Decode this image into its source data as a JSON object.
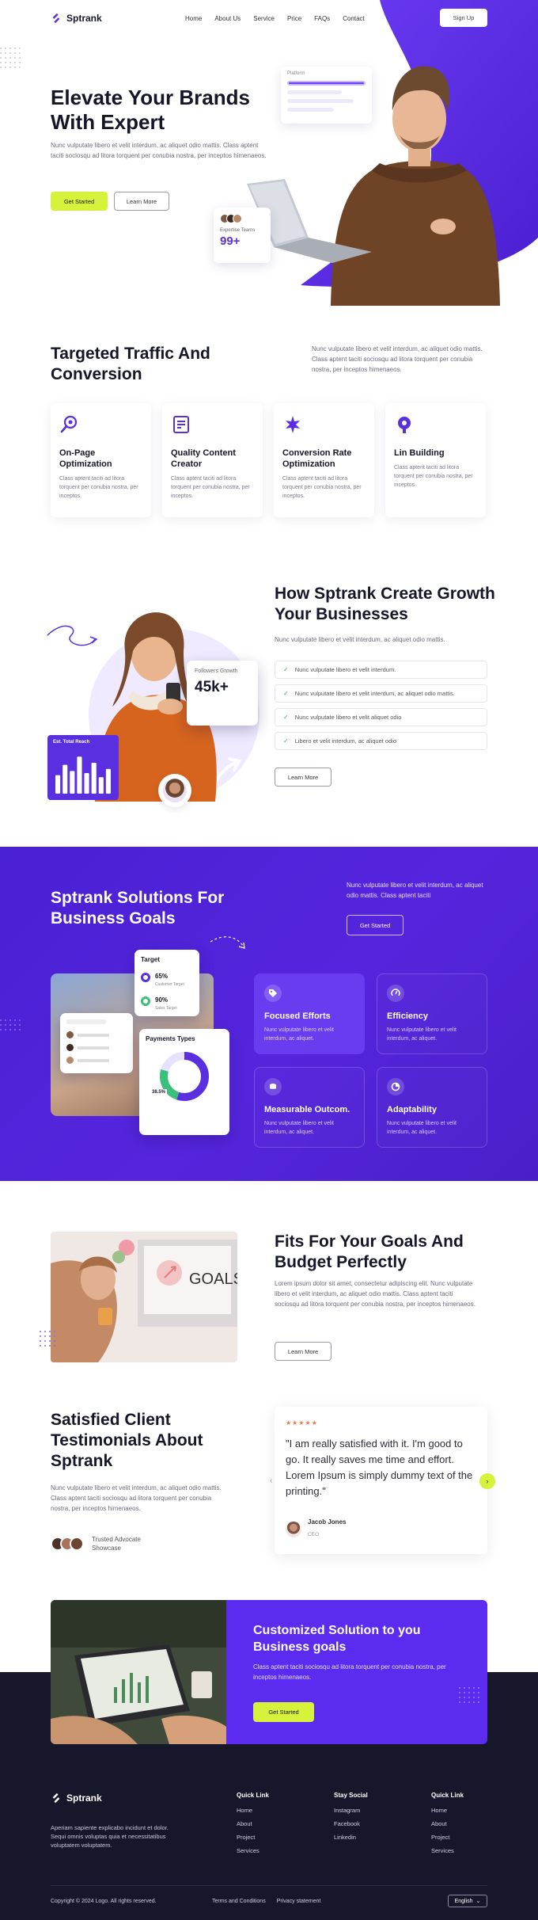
{
  "nav": {
    "brand": "Sptrank",
    "links": [
      "Home",
      "About Us",
      "Service",
      "Price",
      "FAQs",
      "Contact"
    ],
    "signup": "Sign Up"
  },
  "hero": {
    "title": "Elevate Your Brands With Expert",
    "description": "Nunc vulputate libero et velit interdum, ac aliquet odio mattis. Class aptent taciti sociosqu ad litora torquent per conubia nostra, per inceptos himenaeos.",
    "primary_cta": "Get Started",
    "secondary_cta": "Learn More",
    "platform_label": "Platform",
    "expertise_label": "Expertise Teams",
    "expertise_value": "99+"
  },
  "targeted": {
    "title": "Targeted Traffic And Conversion",
    "description": "Nunc vulputate libero et velit interdum, ac aliquet odio mattis. Class aptent taciti sociosqu ad litora torquent per conubia nostra, per inceptos himenaeos.",
    "cards": [
      {
        "icon": "magnifier-icon",
        "title": "On-Page Optimization",
        "text": "Class aptent taciti ad litora torquent per conubia nostra, per inceptos."
      },
      {
        "icon": "document-check-icon",
        "title": "Quality Content Creator",
        "text": "Class aptent taciti ad litora torquent per conubia nostra, per inceptos."
      },
      {
        "icon": "sparkle-gear-icon",
        "title": "Conversion Rate Optimization",
        "text": "Class aptent taciti ad litora torquent per conubia nostra, per inceptos."
      },
      {
        "icon": "link-building-icon",
        "title": "Lin Building",
        "text": "Class aptent taciti ad litora torquent per conubia nostra, per inceptos."
      }
    ]
  },
  "how": {
    "title": "How Sptrank Create Growth Your Businesses",
    "description": "Nunc vulputate libero et velit interdum, ac aliquet odio mattis.",
    "checklist": [
      "Nunc vulputate libero et velit interdum.",
      "Nunc vulputate libero et velit interdum, ac aliquet odio mattis.",
      "Nunc vulputate libero et velit  aliquet odio",
      "Libero et velit interdum, ac aliquet odio"
    ],
    "cta": "Learn More",
    "followers_label": "Followers Growth",
    "followers_value": "45k+",
    "reach_label": "Est. Total Reach",
    "reach_bars": [
      0.45,
      0.7,
      0.55,
      0.9,
      0.5,
      0.75,
      0.4,
      0.6
    ]
  },
  "solutions": {
    "title": "Sptrank Solutions For Business Goals",
    "description": "Nunc vulputate libero et velit interdum, ac aliquet odio mattis. Class aptent taciti",
    "cta": "Get Started",
    "target_card": {
      "title": "Target",
      "p1": "65%",
      "p1_label": "Customer Target",
      "p2": "90%",
      "p2_label": "Sales Target"
    },
    "payments_card": {
      "title": "Payments Types",
      "value": "38.5%"
    },
    "cards": [
      {
        "icon": "tag-icon",
        "title": "Focused Efforts",
        "text": "Nunc vulputate libero et velit interdum, ac aliquet."
      },
      {
        "icon": "gauge-icon",
        "title": "Efficiency",
        "text": "Nunc vulputate libero et velit interdum, ac aliquet."
      },
      {
        "icon": "coins-icon",
        "title": "Measurable Outcom.",
        "text": "Nunc vulputate libero et velit interdum, ac aliquet."
      },
      {
        "icon": "chart-circle-icon",
        "title": "Adaptability",
        "text": "Nunc vulputate libero et velit interdum, ac aliquet."
      }
    ],
    "colors": {
      "accent": "#5525dd",
      "lime": "#d6f23a"
    }
  },
  "fits": {
    "title": "Fits For Your Goals And Budget Perfectly",
    "description": "Lorem ipsum dolor sit amet, consectetur adipiscing elit. Nunc vulputate libero et velit interdum, ac aliquet odio mattis. Class aptent taciti sociosqu ad litora torquent per conubia nostra, per inceptos himenaeos.",
    "cta": "Learn More",
    "image_text": "GOALS"
  },
  "testimonials": {
    "title": "Satisfied Client Testimonials About Sptrank",
    "description": "Nunc vulputate libero et velit interdum, ac aliquet odio mattis. Class aptent taciti sociosqu ad litora torquent per conubia nostra, per inceptos himenaeos.",
    "trusted": "Trusted Advocate Showcase",
    "stars": "★★★★★",
    "quote": "\"I am really satisfied with it. I'm good to go. It really saves me time and effort. Lorem Ipsum is simply dummy text of the printing.\"",
    "author": "Jacob Jones",
    "role": "CEO"
  },
  "cta": {
    "title": "Customized Solution to you Business  goals",
    "description": "Class aptent taciti sociosqu ad litora torquent per conubia nostra, per inceptos himenaeos.",
    "button": "Get Started"
  },
  "footer": {
    "brand": "Sptrank",
    "description": "Aperiam sapiente explicabo incidunt et dolor. Sequi omnis voluptas quia et necessitatibus voluptatem voluptatem.",
    "columns": [
      {
        "title": "Quick Link",
        "links": [
          "Home",
          "About",
          "Project",
          "Services"
        ]
      },
      {
        "title": "Stay Social",
        "links": [
          "Instagram",
          "Facebook",
          "Linkedin"
        ]
      },
      {
        "title": "Quick Link",
        "links": [
          "Home",
          "About",
          "Project",
          "Services"
        ]
      }
    ],
    "copyright": "Copyright © 2024 Logo. All rights reserved.",
    "terms": "Terms and Conditions",
    "privacy": "Privacy statement",
    "language": "English"
  }
}
